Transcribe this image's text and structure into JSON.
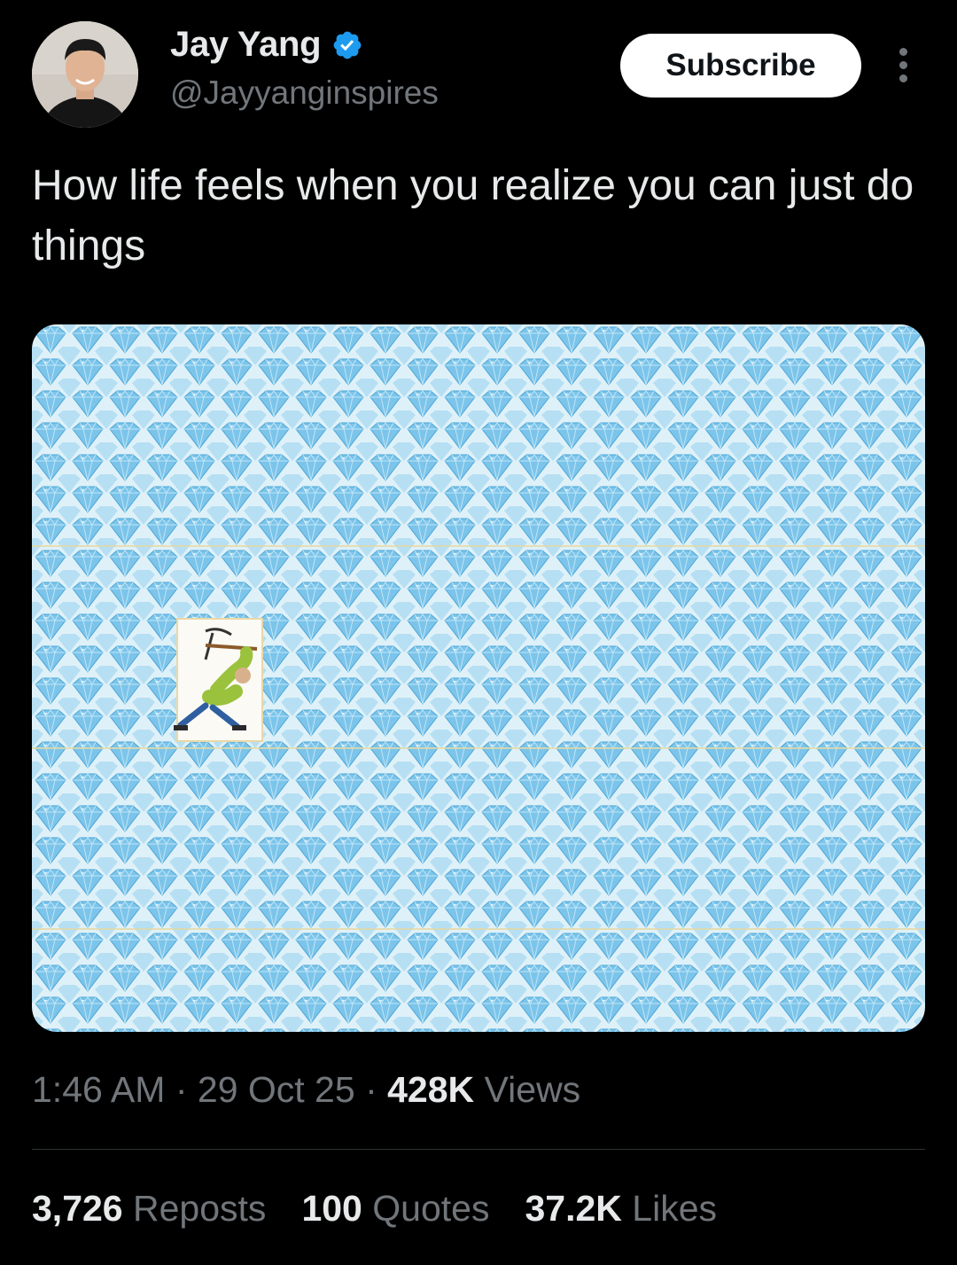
{
  "author": {
    "name": "Jay Yang",
    "handle": "@Jayyanginspires",
    "verified_color": "#1d9bf0"
  },
  "actions": {
    "subscribe_label": "Subscribe",
    "more_icon": "more-vertical-icon"
  },
  "tweet": {
    "text": "How life feels when you realize you can just do things",
    "media_alt": "Field of blue diamonds with a small cartoon miner swinging a pickaxe"
  },
  "meta": {
    "time": "1:46 AM",
    "date": "29 Oct 25",
    "views_count": "428K",
    "views_label": "Views"
  },
  "stats": {
    "reposts_count": "3,726",
    "reposts_label": "Reposts",
    "quotes_count": "100",
    "quotes_label": "Quotes",
    "likes_count": "37.2K",
    "likes_label": "Likes"
  },
  "colors": {
    "background": "#000000",
    "diamond_blue": "#7cc4ea",
    "media_bg": "#d9eef7"
  }
}
